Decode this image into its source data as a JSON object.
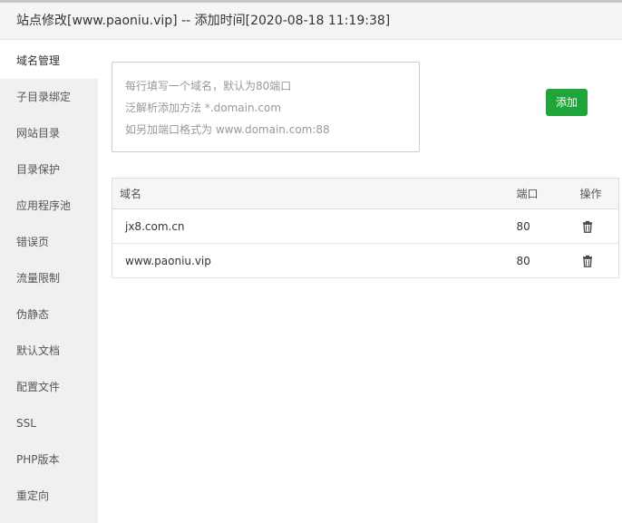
{
  "window": {
    "title": "站点修改[www.paoniu.vip] -- 添加时间[2020-08-18 11:19:38]"
  },
  "sidebar": {
    "items": [
      {
        "label": "域名管理",
        "active": true
      },
      {
        "label": "子目录绑定"
      },
      {
        "label": "网站目录"
      },
      {
        "label": "目录保护"
      },
      {
        "label": "应用程序池"
      },
      {
        "label": "错误页"
      },
      {
        "label": "流量限制"
      },
      {
        "label": "伪静态"
      },
      {
        "label": "默认文档"
      },
      {
        "label": "配置文件"
      },
      {
        "label": "SSL"
      },
      {
        "label": "PHP版本"
      },
      {
        "label": "重定向"
      }
    ]
  },
  "domain_form": {
    "placeholder_lines": [
      "每行填写一个域名，默认为80端口",
      "泛解析添加方法 *.domain.com",
      "如另加端口格式为 www.domain.com:88"
    ],
    "add_label": "添加"
  },
  "domain_table": {
    "headers": {
      "name": "域名",
      "port": "端口",
      "op": "操作"
    },
    "rows": [
      {
        "domain": "jx8.com.cn",
        "port": "80",
        "action_icon": "trash-icon"
      },
      {
        "domain": "www.paoniu.vip",
        "port": "80",
        "action_icon": "trash-icon"
      }
    ]
  },
  "colors": {
    "accent": "#20a53a",
    "sidebar_bg": "#f0f0f0",
    "titlebar_bg": "#f5f5f5"
  }
}
